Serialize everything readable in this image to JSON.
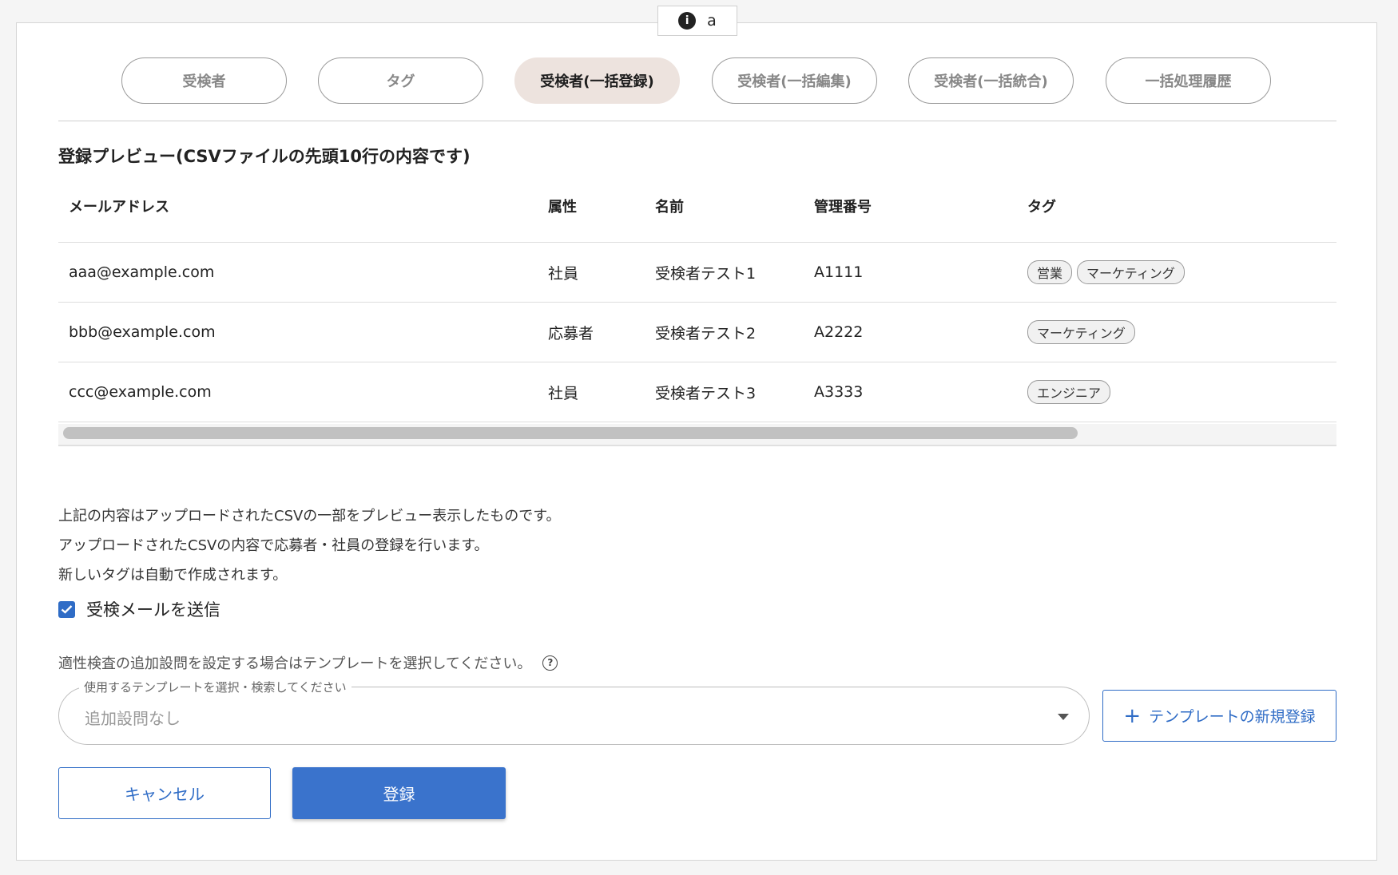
{
  "info_chip": {
    "label": "a"
  },
  "tabs": [
    {
      "label": "受検者",
      "active": false
    },
    {
      "label": "タグ",
      "active": false
    },
    {
      "label": "受検者(一括登録)",
      "active": true
    },
    {
      "label": "受検者(一括編集)",
      "active": false
    },
    {
      "label": "受検者(一括統合)",
      "active": false
    },
    {
      "label": "一括処理履歴",
      "active": false
    }
  ],
  "preview": {
    "title": "登録プレビュー(CSVファイルの先頭10行の内容です)",
    "columns": [
      "メールアドレス",
      "属性",
      "名前",
      "管理番号",
      "タグ"
    ],
    "rows": [
      {
        "email": "aaa@example.com",
        "attribute": "社員",
        "name": "受検者テスト1",
        "id": "A1111",
        "tags": [
          "営業",
          "マーケティング"
        ]
      },
      {
        "email": "bbb@example.com",
        "attribute": "応募者",
        "name": "受検者テスト2",
        "id": "A2222",
        "tags": [
          "マーケティング"
        ]
      },
      {
        "email": "ccc@example.com",
        "attribute": "社員",
        "name": "受検者テスト3",
        "id": "A3333",
        "tags": [
          "エンジニア"
        ]
      }
    ]
  },
  "notes": [
    "上記の内容はアップロードされたCSVの一部をプレビュー表示したものです。",
    "アップロードされたCSVの内容で応募者・社員の登録を行います。",
    "新しいタグは自動で作成されます。"
  ],
  "send_mail": {
    "label": "受検メールを送信",
    "checked": true
  },
  "template": {
    "hint": "適性検査の追加設問を設定する場合はテンプレートを選択してください。",
    "select_legend": "使用するテンプレートを選択・検索してください",
    "select_value": "追加設問なし",
    "new_button_label": "テンプレートの新規登録"
  },
  "actions": {
    "cancel_label": "キャンセル",
    "register_label": "登録"
  },
  "colors": {
    "primary": "#3a73cc",
    "active_tab_bg": "#ede3de"
  }
}
